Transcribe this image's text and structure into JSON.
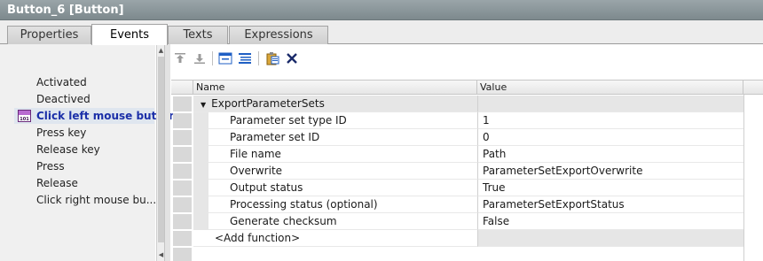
{
  "window": {
    "title": "Button_6 [Button]"
  },
  "tabs": [
    {
      "label": "Properties",
      "active": false
    },
    {
      "label": "Events",
      "active": true
    },
    {
      "label": "Texts",
      "active": false
    },
    {
      "label": "Expressions",
      "active": false
    }
  ],
  "events": [
    {
      "label": "Activated",
      "selected": false
    },
    {
      "label": "Deactived",
      "selected": false
    },
    {
      "label": "Click left mouse button",
      "selected": true,
      "icon": "event-function-icon"
    },
    {
      "label": "Press key",
      "selected": false
    },
    {
      "label": "Release key",
      "selected": false
    },
    {
      "label": "Press",
      "selected": false
    },
    {
      "label": "Release",
      "selected": false
    },
    {
      "label": "Click right mouse bu...",
      "selected": false
    }
  ],
  "toolbar": {
    "buttons": [
      "move-up-icon",
      "move-down-icon",
      "collapse-all-icon",
      "expand-all-icon",
      "paste-function-icon",
      "delete-icon"
    ]
  },
  "grid": {
    "columns": {
      "name": "Name",
      "value": "Value"
    },
    "function": {
      "name": "ExportParameterSets",
      "value": ""
    },
    "params": [
      {
        "name": "Parameter set type ID",
        "value": "1"
      },
      {
        "name": "Parameter set ID",
        "value": "0"
      },
      {
        "name": "File name",
        "value": "Path"
      },
      {
        "name": "Overwrite",
        "value": "ParameterSetExportOverwrite"
      },
      {
        "name": "Output status",
        "value": "True"
      },
      {
        "name": "Processing status (optional)",
        "value": "ParameterSetExportStatus"
      },
      {
        "name": "Generate checksum",
        "value": "False"
      }
    ],
    "add_function": {
      "name": "<Add function>",
      "value": ""
    }
  },
  "colors": {
    "title_bar": "#8a9599",
    "selected_event_text": "#1b2fa8",
    "selected_event_bg": "#dfe6ef",
    "toolbar_accent": "#1f5fc4"
  }
}
